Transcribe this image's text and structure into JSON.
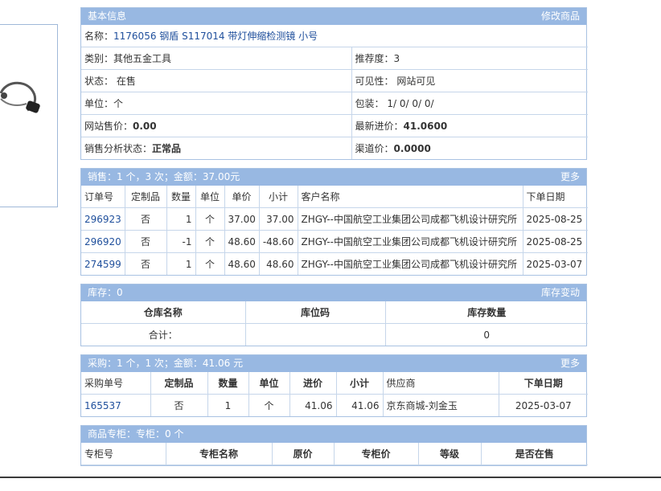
{
  "basic": {
    "title": "基本信息",
    "edit_link": "修改商品",
    "name_label": "名称：",
    "name_value": "1176056 钢盾 S117014 带灯伸缩检测镜 小号",
    "category_label": "类别：",
    "category_value": "其他五金工具",
    "recommend_label": "推荐度：",
    "recommend_value": "3",
    "status_label": "状态：",
    "status_value": "在售",
    "visibility_label": "可见性：",
    "visibility_value": "网站可见",
    "unit_label": "单位：",
    "unit_value": "个",
    "package_label": "包装：",
    "package_value": "1/ 0/ 0/ 0/",
    "site_price_label": "网站售价：",
    "site_price_value": "0.00",
    "latest_cost_label": "最新进价：",
    "latest_cost_value": "41.0600",
    "sales_status_label": "销售分析状态：",
    "sales_status_value": "正常品",
    "channel_price_label": "渠道价：",
    "channel_price_value": "0.0000"
  },
  "sales": {
    "title": "销售：1 个，3 次；金额：37.00元",
    "more_link": "更多",
    "headers": [
      "订单号",
      "定制品",
      "数量",
      "单位",
      "单价",
      "小计",
      "客户名称",
      "下单日期"
    ],
    "rows": [
      [
        "296923",
        "否",
        "1",
        "个",
        "37.00",
        "37.00",
        "ZHGY--中国航空工业集团公司成都飞机设计研究所",
        "2025-08-25"
      ],
      [
        "296920",
        "否",
        "-1",
        "个",
        "48.60",
        "-48.60",
        "ZHGY--中国航空工业集团公司成都飞机设计研究所",
        "2025-08-25"
      ],
      [
        "274599",
        "否",
        "1",
        "个",
        "48.60",
        "48.60",
        "ZHGY--中国航空工业集团公司成都飞机设计研究所",
        "2025-03-07"
      ]
    ]
  },
  "stock": {
    "title": "库存：0",
    "change_link": "库存变动",
    "headers": [
      "仓库名称",
      "库位码",
      "库存数量"
    ],
    "total_label": "合计：",
    "total_location": "",
    "total_qty": "0"
  },
  "purchase": {
    "title": "采购：1 个，1 次；金额：41.06 元",
    "more_link": "更多",
    "headers": [
      "采购单号",
      "定制品",
      "数量",
      "单位",
      "进价",
      "小计",
      "供应商",
      "下单日期"
    ],
    "rows": [
      [
        "165537",
        "否",
        "1",
        "个",
        "41.06",
        "41.06",
        "京东商城-刘金玉",
        "2025-03-07"
      ]
    ]
  },
  "counter": {
    "title": "商品专柜：专柜：0 个",
    "headers": [
      "专柜号",
      "专柜名称",
      "原价",
      "专柜价",
      "等级",
      "是否在售"
    ]
  },
  "colors": {
    "panel_header": "#98b8e2",
    "link": "#1f4f9c",
    "border": "#c6d6ea"
  },
  "icons": {
    "product_thumbnail": "inspection-mirror-image"
  }
}
